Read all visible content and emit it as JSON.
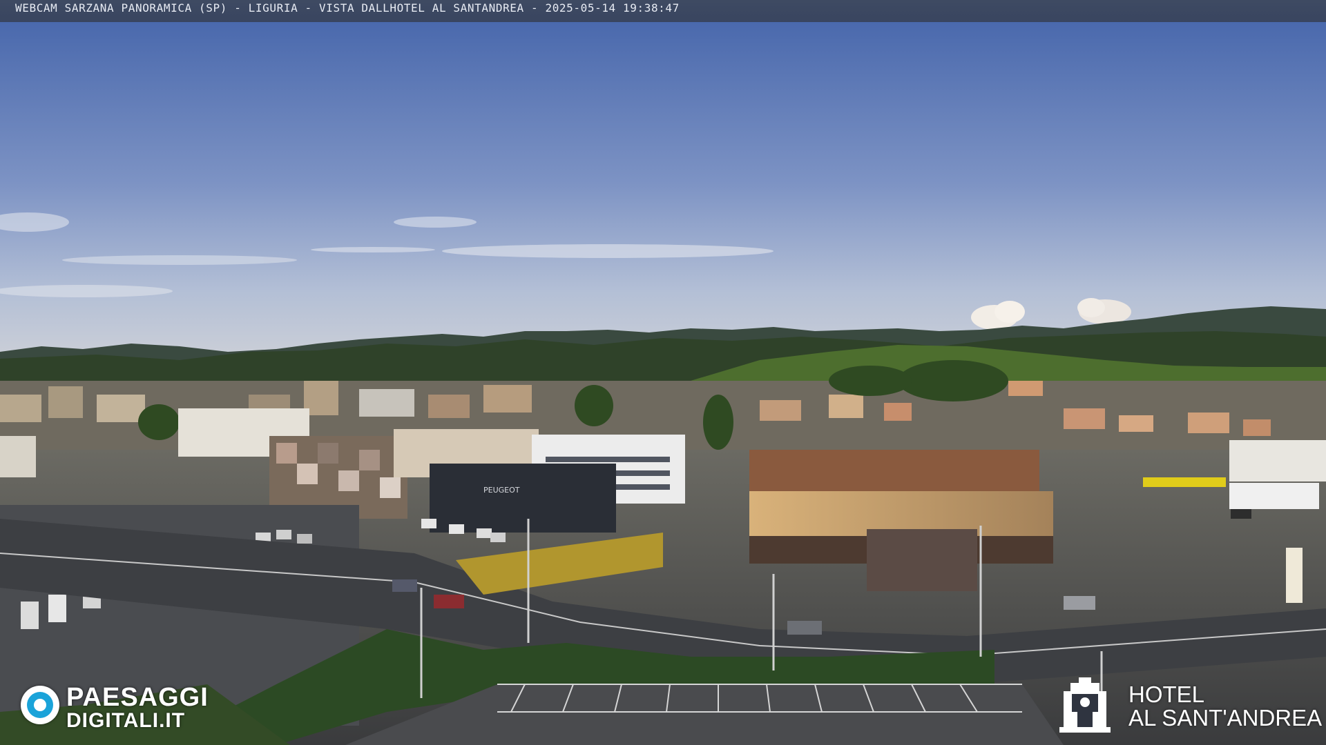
{
  "caption": {
    "text": "WEBCAM SARZANA PANORAMICA (SP) - LIGURIA - VISTA DALLHOTEL AL SANTANDREA - 2025-05-14  19:38:47"
  },
  "logos": {
    "left": {
      "line1": "PAESAGGI",
      "line2": "DIGITALI.IT",
      "icon": "eye-logo-icon",
      "accent": "#1aa3d9"
    },
    "right": {
      "line1": "HOTEL",
      "line2": "AL SANT'ANDREA",
      "icon": "hotel-emblem-icon"
    }
  },
  "scene": {
    "sky_top": "#4f6fb0",
    "sky_bottom": "#c9cfd9",
    "mountains": "#2d3b2f",
    "hills": "#3b5a2c",
    "road": "#3a3d42",
    "sign_text": "PEUGEOT"
  }
}
